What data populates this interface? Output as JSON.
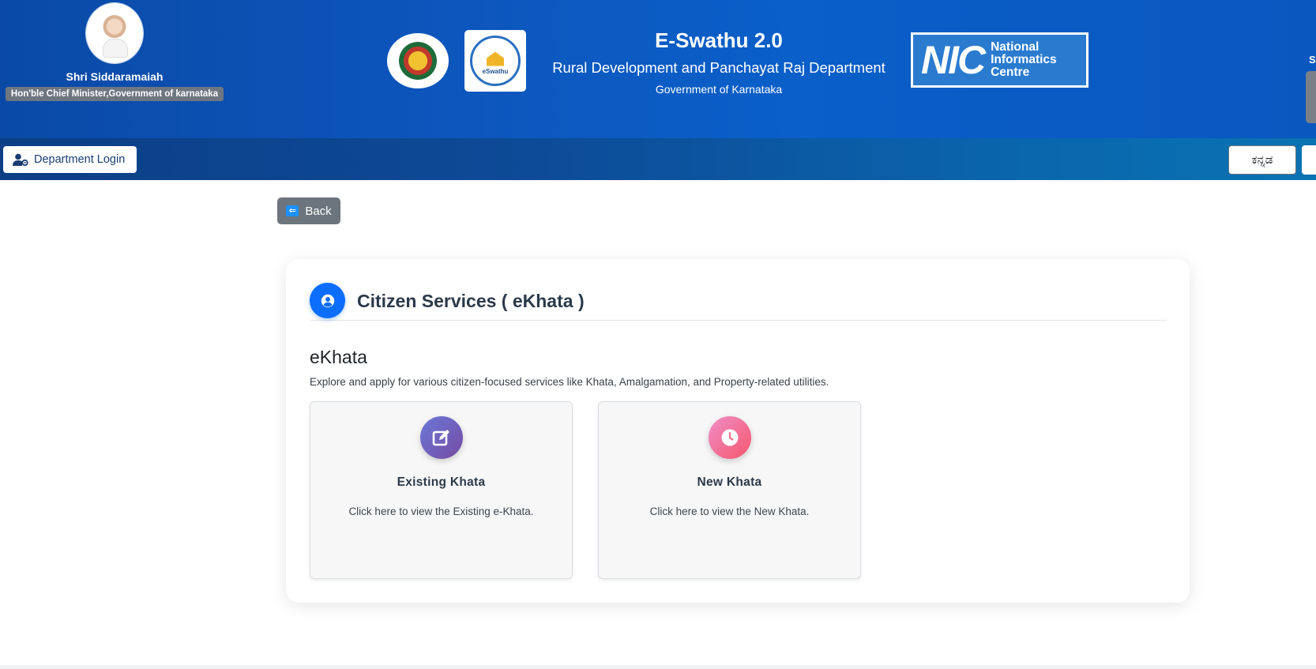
{
  "header": {
    "cm_name": "Shri Siddaramaiah",
    "cm_title": "Hon'ble Chief Minister,Government of karnataka",
    "app_title": "E-Swathu 2.0",
    "department": "Rural Development and Panchayat Raj Department",
    "government": "Government of Karnataka",
    "eswathu_logo_text": "eSwathu",
    "nic_abbr": "NIC",
    "nic_full": [
      "National",
      "Informatics",
      "Centre"
    ],
    "right_edge_letter": "S"
  },
  "navbar": {
    "department_login": "Department Login",
    "language_button": "ಕನ್ನಡ"
  },
  "back_button": "Back",
  "card": {
    "heading": "Citizen Services ( eKhata )",
    "section_title": "eKhata",
    "section_description": "Explore and apply for various citizen-focused services like Khata, Amalgamation, and Property-related utilities.",
    "services": [
      {
        "title": "Existing Khata",
        "description": "Click here to view the Existing e-Khata.",
        "icon": "edit-icon"
      },
      {
        "title": "New Khata",
        "description": "Click here to view the New Khata.",
        "icon": "clock-icon"
      }
    ]
  },
  "colors": {
    "header_blue": "#0d56bd",
    "primary": "#0d6efd",
    "back_gray": "#6c757d",
    "existing_gradient": [
      "#6a78d8",
      "#764ba2"
    ],
    "new_gradient": [
      "#f08ec8",
      "#f5576c"
    ]
  }
}
